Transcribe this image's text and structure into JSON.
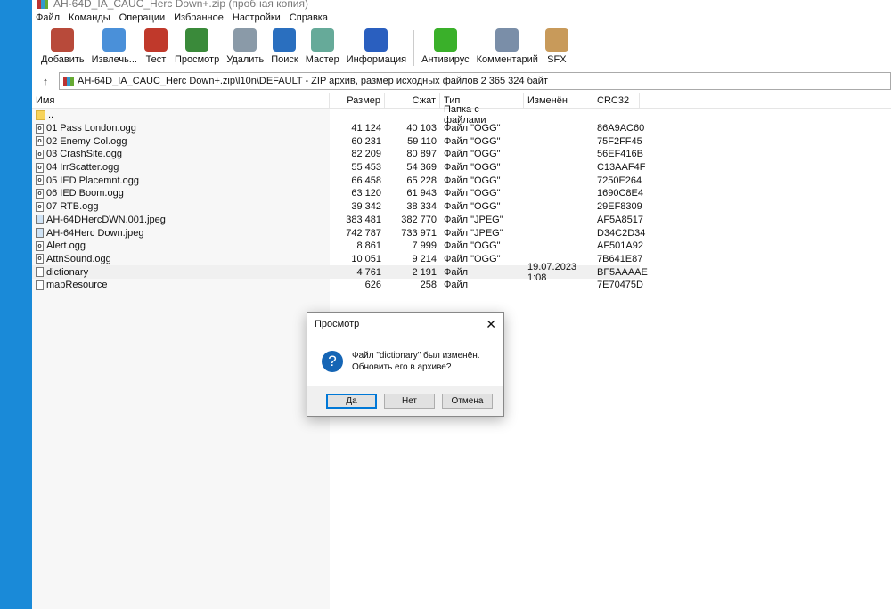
{
  "window": {
    "title": "AH-64D_IA_CAUC_Herc Down+.zip (пробная копия)"
  },
  "menu": [
    "Файл",
    "Команды",
    "Операции",
    "Избранное",
    "Настройки",
    "Справка"
  ],
  "toolbar": [
    {
      "label": "Добавить",
      "icon": "add-archive-icon",
      "color": "#b84a3a"
    },
    {
      "label": "Извлечь...",
      "icon": "extract-folder-icon",
      "color": "#4a90d9"
    },
    {
      "label": "Тест",
      "icon": "test-clipboard-icon",
      "color": "#c0392b"
    },
    {
      "label": "Просмотр",
      "icon": "view-book-icon",
      "color": "#3a8a3a"
    },
    {
      "label": "Удалить",
      "icon": "trash-icon",
      "color": "#8a9aa8"
    },
    {
      "label": "Поиск",
      "icon": "search-magnifier-icon",
      "color": "#2a6fbf"
    },
    {
      "label": "Мастер",
      "icon": "wizard-wand-icon",
      "color": "#6a9"
    },
    {
      "label": "Информация",
      "icon": "info-icon",
      "color": "#2a5fbf"
    },
    {
      "label": "Антивирус",
      "icon": "antivirus-bug-icon",
      "color": "#3ab02a"
    },
    {
      "label": "Комментарий",
      "icon": "comment-icon",
      "color": "#7a8ea8"
    },
    {
      "label": "SFX",
      "icon": "sfx-box-icon",
      "color": "#c89a5a"
    }
  ],
  "address": {
    "path": "AH-64D_IA_CAUC_Herc Down+.zip\\l10n\\DEFAULT - ZIP архив, размер исходных файлов 2 365 324 байт"
  },
  "columns": [
    "Имя",
    "Размер",
    "Сжат",
    "Тип",
    "Изменён",
    "CRC32"
  ],
  "files": [
    {
      "name": "..",
      "size": "",
      "packed": "",
      "type": "Папка с файлами",
      "modified": "",
      "crc": "",
      "icon": "folder"
    },
    {
      "name": "01 Pass London.ogg",
      "size": "41 124",
      "packed": "40 103",
      "type": "Файл \"OGG\"",
      "modified": "",
      "crc": "86A9AC60",
      "icon": "ogg"
    },
    {
      "name": "02 Enemy Col.ogg",
      "size": "60 231",
      "packed": "59 110",
      "type": "Файл \"OGG\"",
      "modified": "",
      "crc": "75F2FF45",
      "icon": "ogg"
    },
    {
      "name": "03 CrashSite.ogg",
      "size": "82 209",
      "packed": "80 897",
      "type": "Файл \"OGG\"",
      "modified": "",
      "crc": "56EF416B",
      "icon": "ogg"
    },
    {
      "name": "04 IrrScatter.ogg",
      "size": "55 453",
      "packed": "54 369",
      "type": "Файл \"OGG\"",
      "modified": "",
      "crc": "C13AAF4F",
      "icon": "ogg"
    },
    {
      "name": "05 IED Placemnt.ogg",
      "size": "66 458",
      "packed": "65 228",
      "type": "Файл \"OGG\"",
      "modified": "",
      "crc": "7250E264",
      "icon": "ogg"
    },
    {
      "name": "06 IED Boom.ogg",
      "size": "63 120",
      "packed": "61 943",
      "type": "Файл \"OGG\"",
      "modified": "",
      "crc": "1690C8E4",
      "icon": "ogg"
    },
    {
      "name": "07 RTB.ogg",
      "size": "39 342",
      "packed": "38 334",
      "type": "Файл \"OGG\"",
      "modified": "",
      "crc": "29EF8309",
      "icon": "ogg"
    },
    {
      "name": "AH-64DHercDWN.001.jpeg",
      "size": "383 481",
      "packed": "382 770",
      "type": "Файл \"JPEG\"",
      "modified": "",
      "crc": "AF5A8517",
      "icon": "jpeg"
    },
    {
      "name": "AH-64Herc Down.jpeg",
      "size": "742 787",
      "packed": "733 971",
      "type": "Файл \"JPEG\"",
      "modified": "",
      "crc": "D34C2D34",
      "icon": "jpeg"
    },
    {
      "name": "Alert.ogg",
      "size": "8 861",
      "packed": "7 999",
      "type": "Файл \"OGG\"",
      "modified": "",
      "crc": "AF501A92",
      "icon": "ogg"
    },
    {
      "name": "AttnSound.ogg",
      "size": "10 051",
      "packed": "9 214",
      "type": "Файл \"OGG\"",
      "modified": "",
      "crc": "7B641E87",
      "icon": "ogg"
    },
    {
      "name": "dictionary",
      "size": "4 761",
      "packed": "2 191",
      "type": "Файл",
      "modified": "19.07.2023 1:08",
      "crc": "BF5AAAAE",
      "icon": "file",
      "selected": true
    },
    {
      "name": "mapResource",
      "size": "626",
      "packed": "258",
      "type": "Файл",
      "modified": "",
      "crc": "7E70475D",
      "icon": "file"
    }
  ],
  "dialog": {
    "title": "Просмотр",
    "line1": "Файл \"dictionary\" был изменён.",
    "line2": "Обновить его в архиве?",
    "yes": "Да",
    "no": "Нет",
    "cancel": "Отмена"
  }
}
